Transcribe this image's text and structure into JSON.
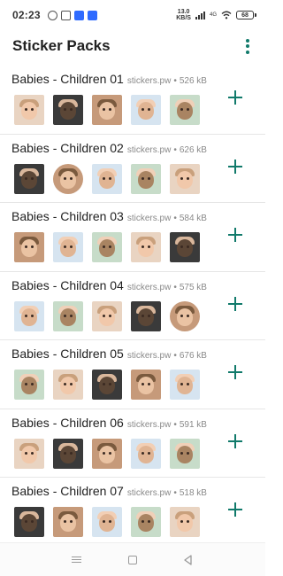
{
  "status_bar": {
    "time": "02:23",
    "net_speed_value": "13.0",
    "net_speed_unit": "KB/S",
    "sim_label": "4G",
    "battery": "68",
    "left_icons": [
      "notification-ring-icon",
      "message-box-icon",
      "blue-app-icon",
      "bluetooth-icon"
    ]
  },
  "app_bar": {
    "title": "Sticker Packs",
    "overflow_icon": "more-vert-icon"
  },
  "accent_color": "#117a6b",
  "packs": [
    {
      "name": "Babies - Children 01",
      "publisher": "stickers.pw",
      "size": "526 kB"
    },
    {
      "name": "Babies - Children 02",
      "publisher": "stickers.pw",
      "size": "626 kB"
    },
    {
      "name": "Babies - Children 03",
      "publisher": "stickers.pw",
      "size": "584 kB"
    },
    {
      "name": "Babies - Children 04",
      "publisher": "stickers.pw",
      "size": "575 kB"
    },
    {
      "name": "Babies - Children 05",
      "publisher": "stickers.pw",
      "size": "676 kB"
    },
    {
      "name": "Babies - Children 06",
      "publisher": "stickers.pw",
      "size": "591 kB"
    },
    {
      "name": "Babies - Children 07",
      "publisher": "stickers.pw",
      "size": "518 kB"
    }
  ],
  "meta_separator": "•",
  "nav_bar": {
    "icons": [
      "menu-icon",
      "home-icon",
      "back-icon"
    ]
  }
}
